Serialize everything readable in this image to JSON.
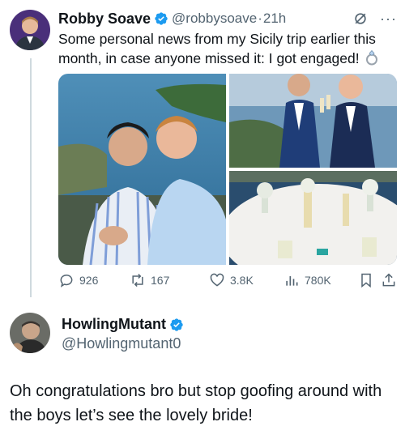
{
  "tweet": {
    "author_name": "Robby Soave",
    "author_handle": "@robbysoave",
    "dot": "·",
    "time": "21h",
    "text": "Some personal news from my Sicily trip earlier this month, in case anyone missed it: I got engaged!",
    "emoji_icon": "ring-icon",
    "stats": {
      "replies": "926",
      "reposts": "167",
      "likes": "3.8K",
      "views": "780K"
    }
  },
  "reply": {
    "author_name": "HowlingMutant",
    "author_handle": "@Howlingmutant0",
    "text": "Oh congratulations bro but stop goofing around with the boys let’s see the lovely bride!"
  },
  "colors": {
    "verified": "#1d9bf0",
    "secondary_text": "#536471",
    "thread_line": "#cfd9de"
  }
}
